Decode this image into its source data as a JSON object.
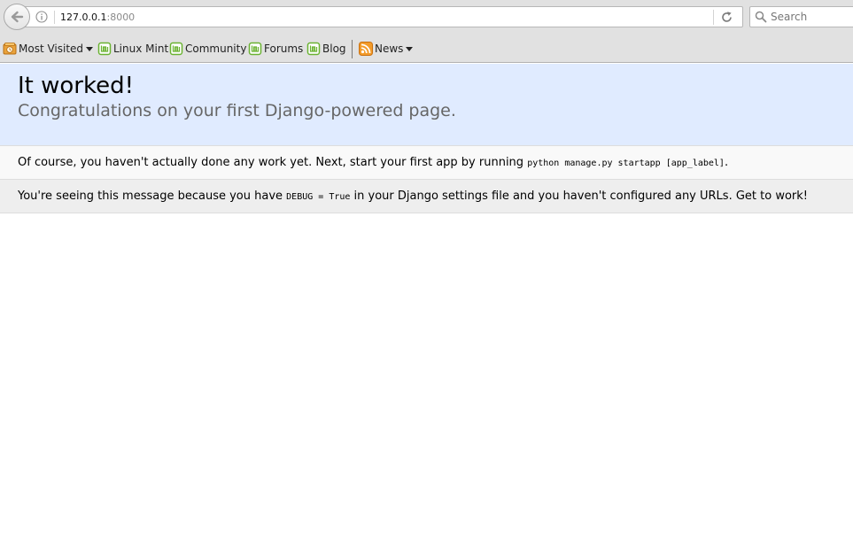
{
  "browser": {
    "url_host": "127.0.0.1",
    "url_port": ":8000",
    "search_placeholder": "Search",
    "bookmarks": [
      {
        "label": "Most Visited",
        "icon": "most-visited-icon"
      },
      {
        "label": "Linux Mint",
        "icon": "mint-icon"
      },
      {
        "label": "Community",
        "icon": "mint-icon"
      },
      {
        "label": "Forums",
        "icon": "mint-icon"
      },
      {
        "label": "Blog",
        "icon": "mint-icon"
      },
      {
        "label": "News",
        "icon": "rss-feed-icon"
      }
    ]
  },
  "page": {
    "title": "It worked!",
    "subtitle": "Congratulations on your first Django-powered page.",
    "instructions_prefix": "Of course, you haven't actually done any work yet. Next, start your first app by running",
    "instructions_code": "python manage.py startapp [app_label]",
    "instructions_suffix": ".",
    "explanation_prefix": "You're seeing this message because you have",
    "explanation_code": "DEBUG = True",
    "explanation_suffix": "in your Django settings file and you haven't configured any URLs. Get to work!"
  },
  "colors": {
    "summary_bg": "#e0ebff",
    "subtitle": "#666666",
    "instructions_bg": "#f9f9f9",
    "explanation_bg": "#eeeeee",
    "mint_green": "#6ab231",
    "rss_orange": "#f39b2a"
  }
}
